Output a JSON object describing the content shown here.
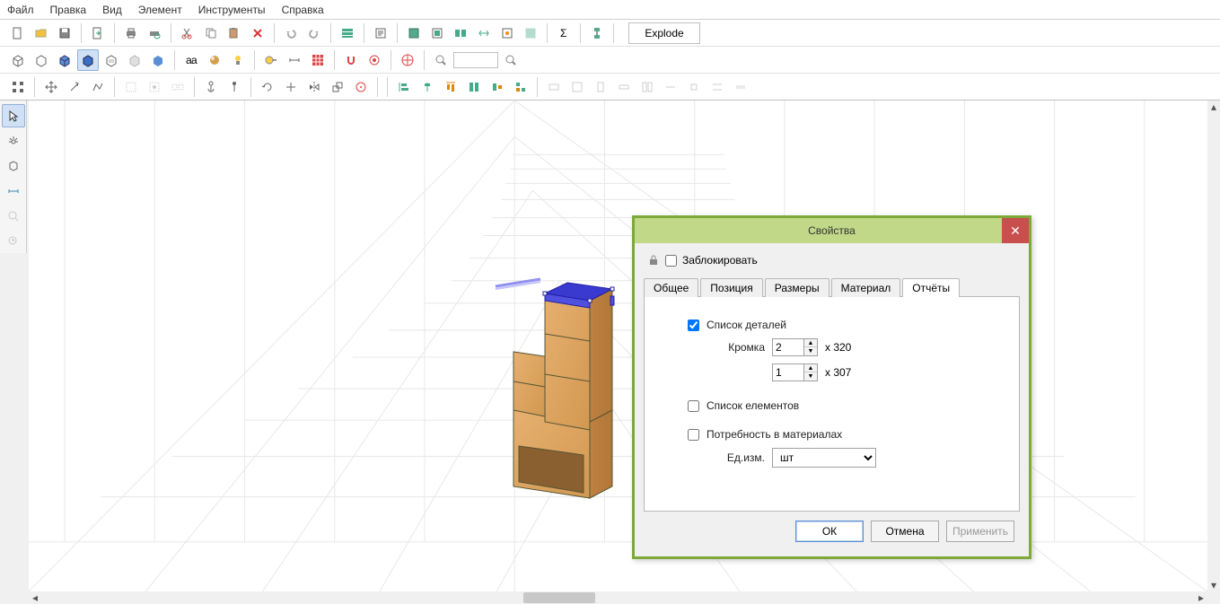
{
  "menu": {
    "file": "Файл",
    "edit": "Правка",
    "view": "Вид",
    "element": "Элемент",
    "tools": "Инструменты",
    "help": "Справка"
  },
  "toolbar": {
    "explode": "Explode"
  },
  "dialog": {
    "title": "Свойства",
    "lock_label": "Заблокировать",
    "tabs": {
      "general": "Общее",
      "position": "Позиция",
      "dimensions": "Размеры",
      "material": "Материал",
      "reports": "Отчёты"
    },
    "reports": {
      "parts_list_label": "Список деталей",
      "parts_list_checked": true,
      "edge_label": "Кромка",
      "edge_value1": "2",
      "edge_dim1": "x 320",
      "edge_value2": "1",
      "edge_dim2": "x 307",
      "elements_list_label": "Список елементов",
      "elements_list_checked": false,
      "material_need_label": "Потребность в материалах",
      "material_need_checked": false,
      "unit_label": "Ед.изм.",
      "unit_value": "шт"
    },
    "buttons": {
      "ok": "ОК",
      "cancel": "Отмена",
      "apply": "Применить"
    }
  }
}
